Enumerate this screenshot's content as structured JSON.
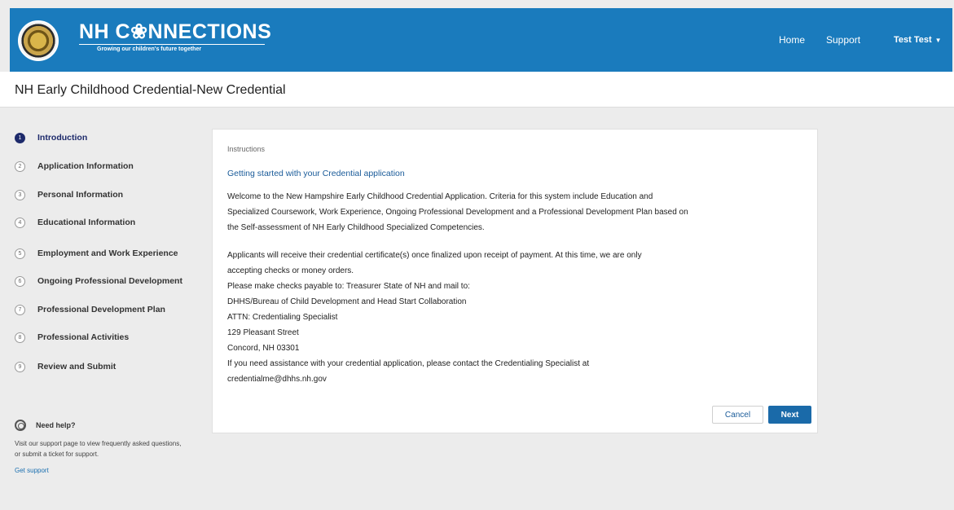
{
  "header": {
    "brand_title": "NH C❀NNECTIONS",
    "brand_tagline": "Growing our children's future together",
    "nav": {
      "home": "Home",
      "support": "Support",
      "user": "Test Test"
    }
  },
  "page_title": "NH Early Childhood Credential-New Credential",
  "steps": [
    {
      "number": "1",
      "label": "Introduction",
      "active": true
    },
    {
      "number": "2",
      "label": "Application Information",
      "active": false
    },
    {
      "number": "3",
      "label": "Personal Information",
      "active": false
    },
    {
      "number": "4",
      "label": "Educational Information",
      "active": false
    },
    {
      "number": "5",
      "label": "Employment and Work Experience",
      "active": false
    },
    {
      "number": "6",
      "label": "Ongoing Professional Development",
      "active": false
    },
    {
      "number": "7",
      "label": "Professional Development Plan",
      "active": false
    },
    {
      "number": "8",
      "label": "Professional Activities",
      "active": false
    },
    {
      "number": "9",
      "label": "Review and Submit",
      "active": false
    }
  ],
  "help": {
    "title": "Need help?",
    "text": "Visit our support page to view frequently asked questions, or submit a ticket for support.",
    "link": "Get support"
  },
  "card": {
    "label": "Instructions",
    "heading": "Getting started with your Credential application",
    "paragraph1": [
      "Welcome to the New Hampshire Early Childhood Credential Application. Criteria for this system include Education and",
      "Specialized Coursework, Work Experience, Ongoing Professional Development and a Professional Development Plan based on",
      "the Self-assessment of NH Early Childhood Specialized Competencies."
    ],
    "paragraph2": [
      "Applicants will receive their credential certificate(s) once finalized upon receipt of payment. At this time, we are only",
      "accepting checks or money orders.",
      "Please make checks payable to: Treasurer State of NH and mail to:",
      "DHHS/Bureau of Child Development and Head Start Collaboration",
      "ATTN: Credentialing Specialist",
      "129 Pleasant Street",
      "Concord, NH 03301",
      "If you need assistance with your credential application, please contact the Credentialing Specialist at",
      "credentialme@dhhs.nh.gov"
    ],
    "cancel_label": "Cancel",
    "next_label": "Next"
  },
  "colors": {
    "header_blue": "#1a7bbd",
    "active_step": "#1d2a6b",
    "button_primary": "#1a6aa9"
  }
}
